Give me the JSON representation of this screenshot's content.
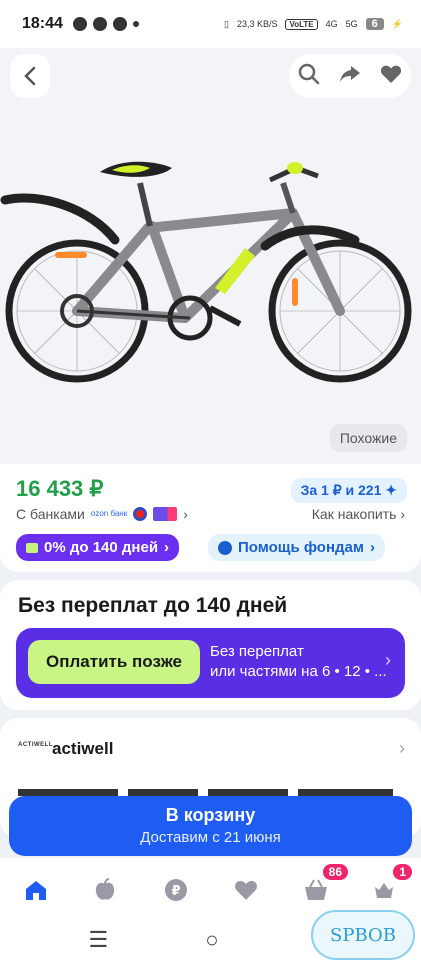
{
  "status_bar": {
    "time": "18:44",
    "network_speed": "23,3 KB/S",
    "volte": "VoLTE",
    "net_4g": "4G",
    "net_5g": "5G",
    "battery": "6"
  },
  "product_image": {
    "similar_label": "Похожие"
  },
  "price_block": {
    "price": "16 433 ₽",
    "points": "За 1 ₽ и 221",
    "banks_label": "С банками",
    "ozon_bank": "ozon банк",
    "save_label": "Как накопить",
    "installment_pill": "0% до 140 дней",
    "charity_pill": "Помощь фондам"
  },
  "installment": {
    "title": "Без переплат до 140 дней",
    "pay_later_label": "Оплатить позже",
    "line1": "Без переплат",
    "line2": "или частями на 6 • 12 • ..."
  },
  "seller": {
    "logo_text": "ACTIWELL",
    "name": "actiwell"
  },
  "cart": {
    "label": "В корзину",
    "delivery": "Доставим с 21 июня"
  },
  "bottom_nav": {
    "cart_badge": "86",
    "profile_badge": "1"
  },
  "watermark": "SPBOB",
  "colors": {
    "price_green": "#20a04a",
    "accent_blue": "#1e5cf2",
    "installment_purple": "#5a2ee4",
    "pay_later_green": "#c9f585",
    "badge_pink": "#f0246b"
  }
}
